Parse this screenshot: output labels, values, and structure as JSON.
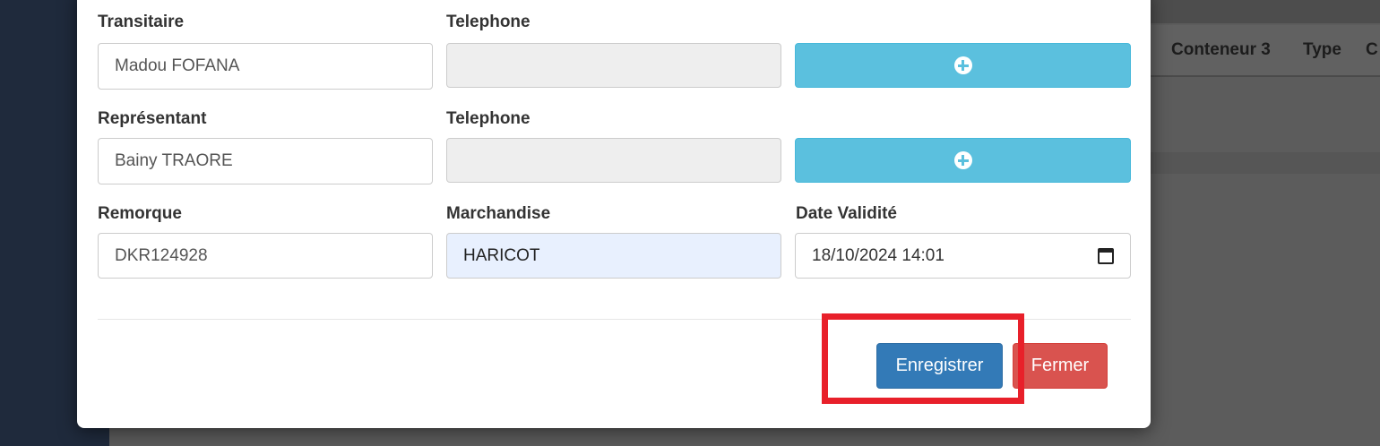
{
  "background": {
    "table_headers": [
      "Conteneur 3",
      "Type",
      "C"
    ]
  },
  "form": {
    "transitaire": {
      "label": "Transitaire",
      "value": "Madou FOFANA"
    },
    "transitaire_phone": {
      "label": "Telephone",
      "value": ""
    },
    "representant": {
      "label": "Représentant",
      "value": "Bainy TRAORE"
    },
    "representant_phone": {
      "label": "Telephone",
      "value": ""
    },
    "remorque": {
      "label": "Remorque",
      "value": "DKR124928"
    },
    "marchandise": {
      "label": "Marchandise",
      "value": "HARICOT"
    },
    "date_validite": {
      "label": "Date Validité",
      "value": "18/10/2024 14:01"
    }
  },
  "footer": {
    "save_label": "Enregistrer",
    "close_label": "Fermer"
  },
  "colors": {
    "info": "#5bc0de",
    "primary": "#337ab7",
    "danger": "#d9534f",
    "highlight": "#e8202a"
  },
  "icons": {
    "add": "plus-circle-icon",
    "calendar": "calendar-icon"
  }
}
